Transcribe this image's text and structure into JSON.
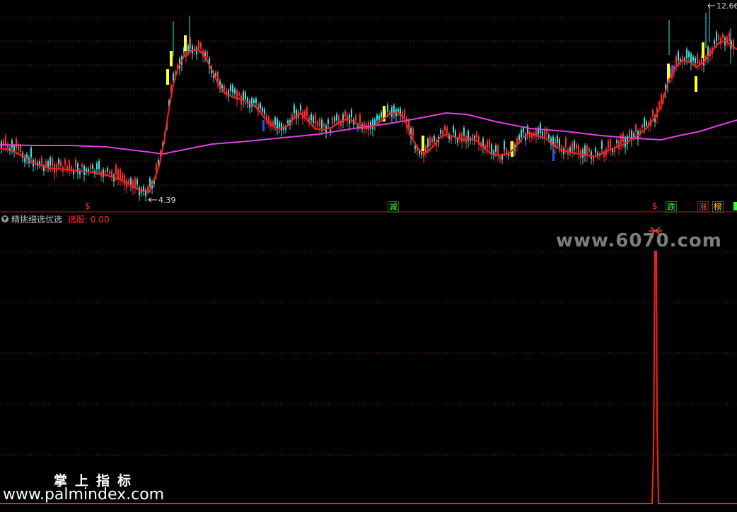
{
  "price_labels": {
    "high": "12.66",
    "low": "4.39"
  },
  "indicator": {
    "name": "精挑细选优选",
    "value_label": "选股: 0.00",
    "collapse_icon": "chevron-down-icon"
  },
  "signals": [
    {
      "text": "$",
      "color": "#ff3030"
    },
    {
      "text": "减",
      "color": "#39ff39"
    },
    {
      "text": "$",
      "color": "#ff3030"
    },
    {
      "text": "跌",
      "color": "#39ff39"
    },
    {
      "text": "涨",
      "color": "#ff5050"
    },
    {
      "text": "榜",
      "color": "#ffd21e"
    }
  ],
  "watermark": "www.6070.com",
  "brand": {
    "cn": "掌上指标",
    "url": "www.palmindex.com"
  },
  "colors": {
    "background": "#000000",
    "ma_short": "#ff2020",
    "ma_long": "#e040e0",
    "candle_up": "#ff3030",
    "candle_down": "#40e0e0",
    "signal_bar": "#ffff30",
    "grid": "#8b2020",
    "indicator_line": "#ff2020"
  }
}
